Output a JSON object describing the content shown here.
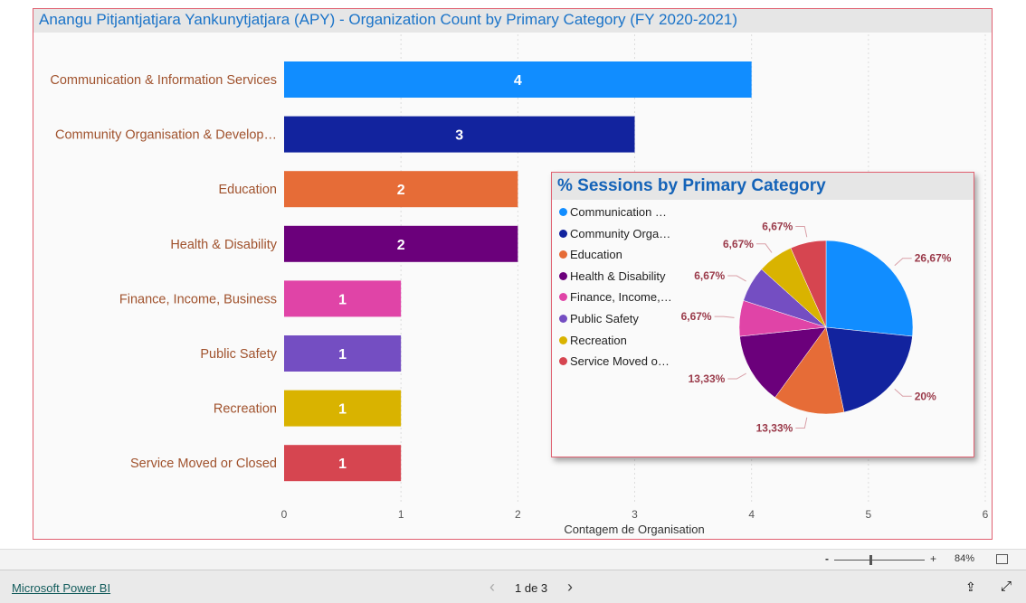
{
  "visual_title": "Anangu Pitjantjatjara Yankunytjatjara (APY) - Organization Count by Primary Category (FY 2020-2021)",
  "chart_data": [
    {
      "type": "bar",
      "orientation": "horizontal",
      "categories": [
        "Communication & Information Services",
        "Community Organisation & Develop…",
        "Education",
        "Health & Disability",
        "Finance, Income, Business",
        "Public Safety",
        "Recreation",
        "Service Moved or Closed"
      ],
      "values": [
        4,
        3,
        2,
        2,
        1,
        1,
        1,
        1
      ],
      "colors": [
        "#118dff",
        "#12239e",
        "#e66c37",
        "#6b007b",
        "#e044a7",
        "#744ec2",
        "#d9b300",
        "#d64550"
      ],
      "xlabel": "Contagem de Organisation",
      "xlim": [
        0,
        6
      ],
      "xticks": [
        "0",
        "1",
        "2",
        "3",
        "4",
        "5",
        "6"
      ],
      "grid": true
    },
    {
      "type": "pie",
      "title": "% Sessions by Primary Category",
      "legend": [
        "Communication …",
        "Community Orga…",
        "Education",
        "Health & Disability",
        "Finance, Income,…",
        "Public Safety",
        "Recreation",
        "Service Moved o…"
      ],
      "values": [
        26.67,
        20,
        13.33,
        13.33,
        6.67,
        6.67,
        6.67,
        6.67
      ],
      "labels": [
        "26,67%",
        "20%",
        "13,33%",
        "13,33%",
        "6,67%",
        "6,67%",
        "6,67%",
        "6,67%"
      ],
      "colors": [
        "#118dff",
        "#12239e",
        "#e66c37",
        "#6b007b",
        "#e044a7",
        "#744ec2",
        "#d9b300",
        "#d64550"
      ],
      "legend_placement": "left"
    }
  ],
  "zoom": {
    "minus": "-",
    "plus": "+",
    "level": "84%",
    "value": 84
  },
  "footer": {
    "brand": "Microsoft Power BI",
    "page": "1 de 3",
    "prev": "‹",
    "next": "›"
  }
}
